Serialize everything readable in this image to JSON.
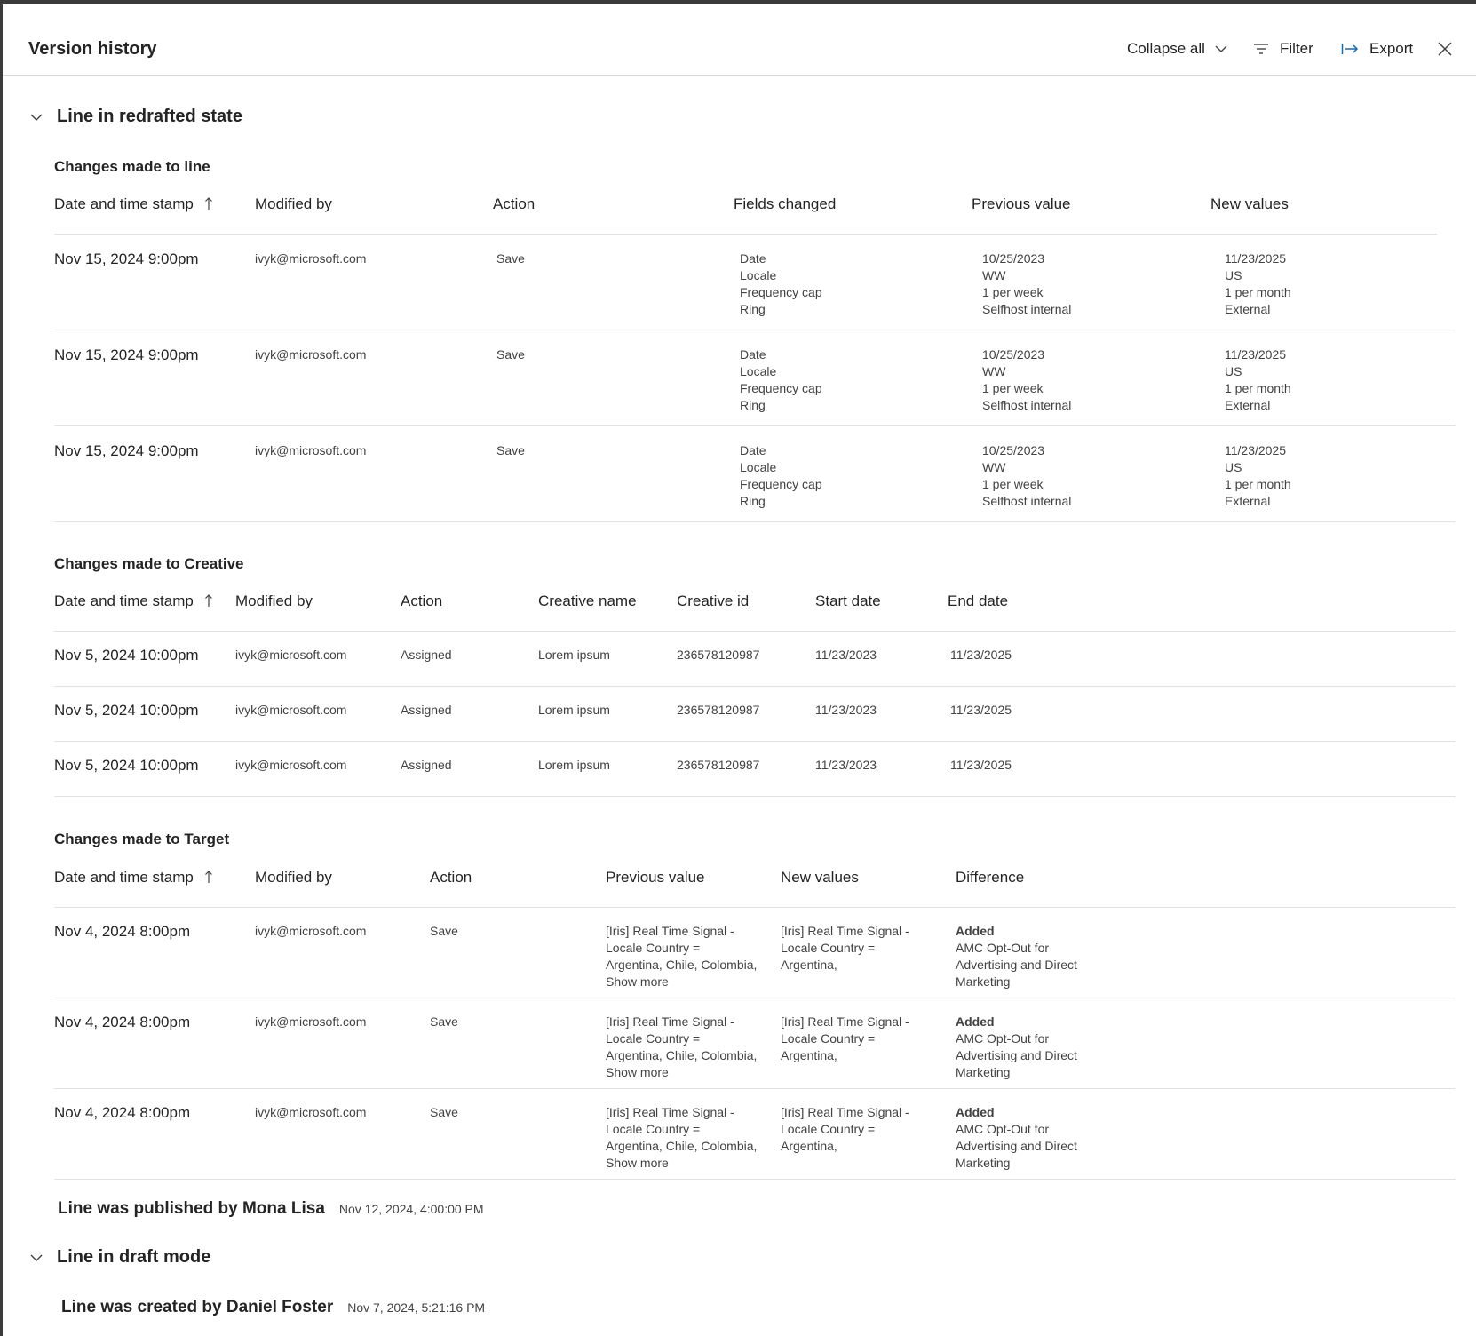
{
  "header": {
    "title": "Version history",
    "collapse_label": "Collapse all",
    "filter_label": "Filter",
    "export_label": "Export"
  },
  "section1": {
    "title": "Line in redrafted state",
    "line_changes": {
      "heading": "Changes made to line",
      "columns": [
        "Date and time stamp",
        "Modified by",
        "Action",
        "Fields changed",
        "Previous value",
        "New values"
      ],
      "rows": [
        {
          "date": "Nov 15, 2024 9:00pm",
          "by": "ivyk@microsoft.com",
          "action": "Save",
          "fields": [
            "Date",
            "Locale",
            "Frequency cap",
            "Ring"
          ],
          "previous": [
            "10/25/2023",
            "WW",
            "1 per week",
            "Selfhost internal"
          ],
          "new": [
            "11/23/2025",
            "US",
            "1 per month",
            "External"
          ]
        },
        {
          "date": "Nov 15, 2024 9:00pm",
          "by": "ivyk@microsoft.com",
          "action": "Save",
          "fields": [
            "Date",
            "Locale",
            "Frequency cap",
            "Ring"
          ],
          "previous": [
            "10/25/2023",
            "WW",
            "1 per week",
            "Selfhost internal"
          ],
          "new": [
            "11/23/2025",
            "US",
            "1 per month",
            "External"
          ]
        },
        {
          "date": "Nov 15, 2024 9:00pm",
          "by": "ivyk@microsoft.com",
          "action": "Save",
          "fields": [
            "Date",
            "Locale",
            "Frequency cap",
            "Ring"
          ],
          "previous": [
            "10/25/2023",
            "WW",
            "1 per week",
            "Selfhost internal"
          ],
          "new": [
            "11/23/2025",
            "US",
            "1 per month",
            "External"
          ]
        }
      ]
    },
    "creative_changes": {
      "heading": "Changes made to Creative",
      "columns": [
        "Date and time stamp",
        "Modified by",
        "Action",
        "Creative name",
        "Creative id",
        "Start date",
        "End date"
      ],
      "rows": [
        {
          "date": "Nov 5, 2024 10:00pm",
          "by": "ivyk@microsoft.com",
          "action": "Assigned",
          "name": "Lorem ipsum",
          "id": "236578120987",
          "start": "11/23/2023",
          "end": "11/23/2025"
        },
        {
          "date": "Nov 5, 2024 10:00pm",
          "by": "ivyk@microsoft.com",
          "action": "Assigned",
          "name": "Lorem ipsum",
          "id": "236578120987",
          "start": "11/23/2023",
          "end": "11/23/2025"
        },
        {
          "date": "Nov 5, 2024 10:00pm",
          "by": "ivyk@microsoft.com",
          "action": "Assigned",
          "name": "Lorem ipsum",
          "id": "236578120987",
          "start": "11/23/2023",
          "end": "11/23/2025"
        }
      ]
    },
    "target_changes": {
      "heading": "Changes made to Target",
      "columns": [
        "Date and time stamp",
        "Modified by",
        "Action",
        "Previous value",
        "New values",
        "Difference"
      ],
      "rows": [
        {
          "date": "Nov 4, 2024 8:00pm",
          "by": "ivyk@microsoft.com",
          "action": "Save",
          "previous": [
            "[Iris] Real Time Signal -",
            "Locale Country =",
            "Argentina, Chile, Colombia,"
          ],
          "show_more": "Show more",
          "new": [
            "[Iris] Real Time Signal -",
            "Locale Country =",
            "Argentina,"
          ],
          "diff_label": "Added",
          "diff": [
            "AMC Opt-Out for",
            "Advertising and Direct",
            "Marketing"
          ]
        },
        {
          "date": "Nov 4, 2024 8:00pm",
          "by": "ivyk@microsoft.com",
          "action": "Save",
          "previous": [
            "[Iris] Real Time Signal -",
            "Locale Country =",
            "Argentina, Chile, Colombia,"
          ],
          "show_more": "Show more",
          "new": [
            "[Iris] Real Time Signal -",
            "Locale Country =",
            "Argentina,"
          ],
          "diff_label": "Added",
          "diff": [
            "AMC Opt-Out for",
            "Advertising and Direct",
            "Marketing"
          ]
        },
        {
          "date": "Nov 4, 2024 8:00pm",
          "by": "ivyk@microsoft.com",
          "action": "Save",
          "previous": [
            "[Iris] Real Time Signal -",
            "Locale Country =",
            "Argentina, Chile, Colombia,"
          ],
          "show_more": "Show more",
          "new": [
            "[Iris] Real Time Signal -",
            "Locale Country =",
            "Argentina,"
          ],
          "diff_label": "Added",
          "diff": [
            "AMC Opt-Out for",
            "Advertising and Direct",
            "Marketing"
          ]
        }
      ]
    }
  },
  "published_event": {
    "title": "Line was published by Mona Lisa",
    "time": "Nov 12, 2024, 4:00:00 PM"
  },
  "section2": {
    "title": "Line in draft mode"
  },
  "created_event": {
    "title": "Line was created by Daniel Foster",
    "time": "Nov 7, 2024, 5:21:16 PM"
  },
  "icons": [
    "chevron-down-icon",
    "filter-icon",
    "export-icon",
    "close-icon",
    "sort-up-arrow-icon"
  ]
}
